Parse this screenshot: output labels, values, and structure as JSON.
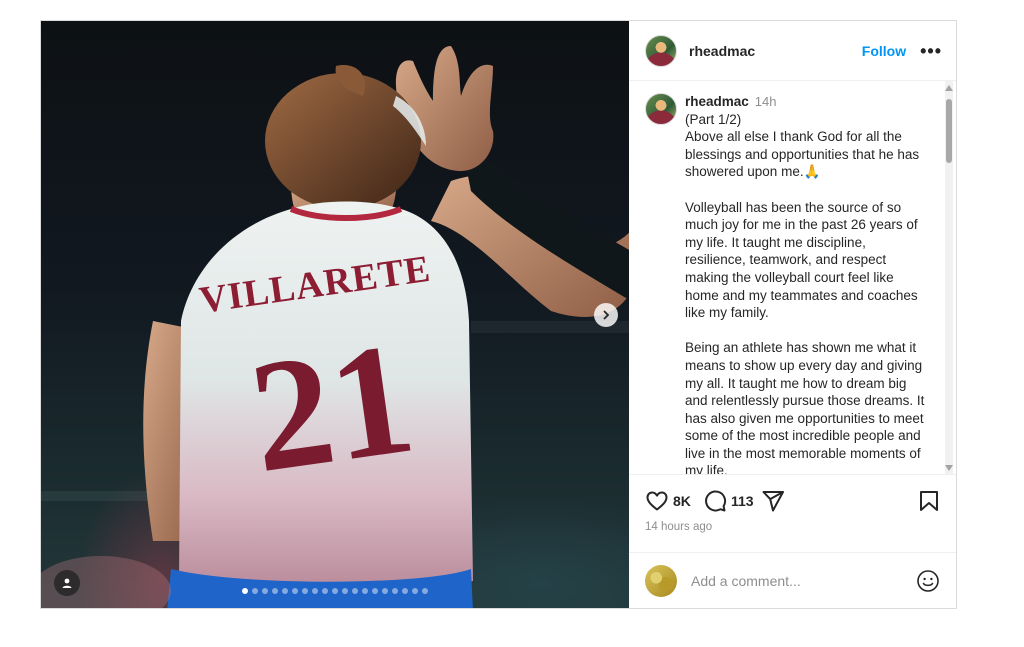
{
  "post": {
    "username": "rheadmac",
    "follow_label": "Follow",
    "more_label": "•••",
    "jersey": {
      "name": "VILLARETE",
      "number": "21"
    },
    "carousel": {
      "slide_count": 19,
      "active_index": 0
    }
  },
  "caption": {
    "username": "rheadmac",
    "time": "14h",
    "paragraphs": [
      "(Part 1/2)\nAbove all else I thank God for all the blessings and opportunities that he has showered upon me.🙏",
      "Volleyball has been the source of so much joy for me in the past 26 years of my life. It taught me discipline, resilience, teamwork, and respect making the volleyball court feel like home and my teammates and coaches like my family.",
      "Being an athlete has shown me what it means to show up every day and giving my all. It taught me how to dream big and relentlessly pursue those dreams. It has also given me opportunities to meet some of the most incredible people and live in the most memorable moments of my life."
    ]
  },
  "actions": {
    "likes": "8K",
    "comments": "113",
    "timestamp": "14 hours ago"
  },
  "comment_box": {
    "placeholder": "Add a comment..."
  },
  "icons": {
    "like": "heart-icon",
    "comment": "comment-icon",
    "share": "send-icon",
    "save": "bookmark-icon",
    "emoji": "smiley-icon",
    "tag": "user-tag-icon",
    "next": "chevron-right-icon"
  },
  "colors": {
    "accent": "#0095f6",
    "muted": "#8e8e8e",
    "text": "#262626"
  }
}
